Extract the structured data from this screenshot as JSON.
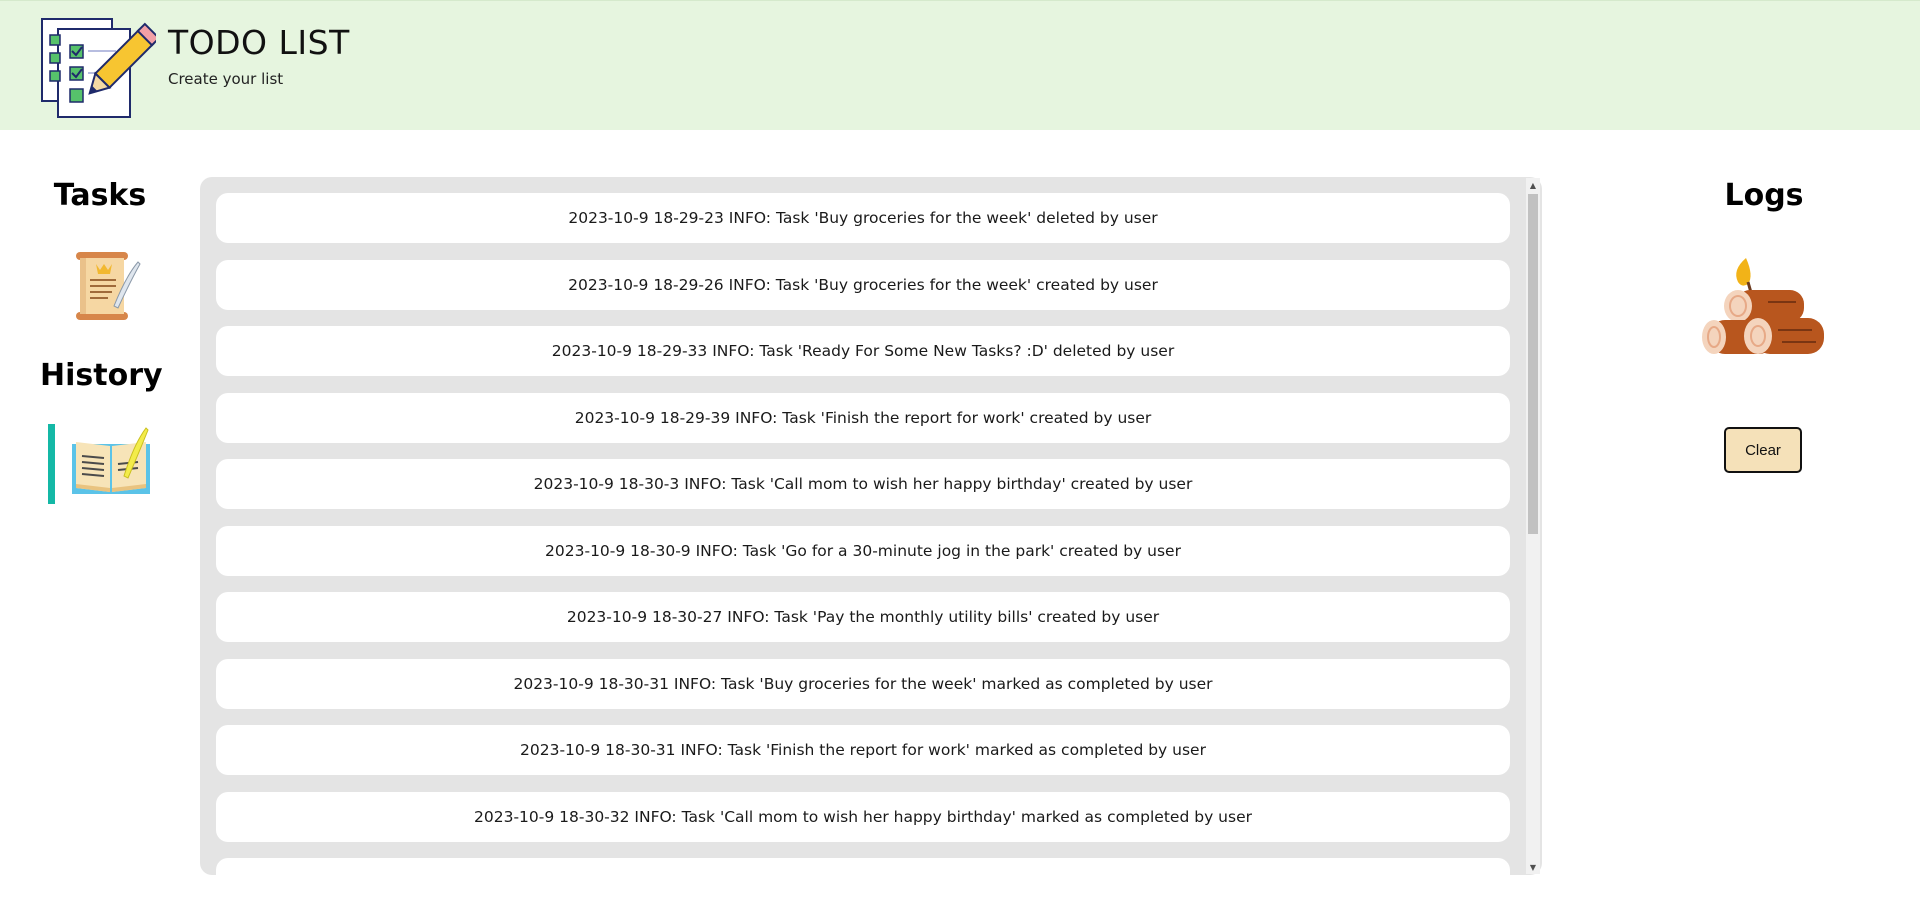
{
  "header": {
    "title": "TODO LIST",
    "subtitle": "Create your list",
    "logo_icon": "checklist-pencil-icon",
    "background": "#e6f5df"
  },
  "sidebar": {
    "tasks_heading": "Tasks",
    "tasks_icon": "scroll-quill-icon",
    "history_heading": "History",
    "history_icon": "open-book-quill-icon",
    "active_item": "History",
    "active_color": "#14b8a6"
  },
  "log_entries": [
    "2023-10-9 18-29-23 INFO: Task 'Buy groceries for the week' deleted by user",
    "2023-10-9 18-29-26 INFO: Task 'Buy groceries for the week' created by user",
    "2023-10-9 18-29-33 INFO: Task 'Ready For Some New Tasks? :D' deleted by user",
    "2023-10-9 18-29-39 INFO: Task 'Finish the report for work' created by user",
    "2023-10-9 18-30-3 INFO: Task 'Call mom to wish her happy birthday' created by user",
    "2023-10-9 18-30-9 INFO: Task 'Go for a 30-minute jog in the park' created by user",
    "2023-10-9 18-30-27 INFO: Task 'Pay the monthly utility bills' created by user",
    "2023-10-9 18-30-31 INFO: Task 'Buy groceries for the week' marked as completed by user",
    "2023-10-9 18-30-31 INFO: Task 'Finish the report for work' marked as completed by user",
    "2023-10-9 18-30-32 INFO: Task 'Call mom to wish her happy birthday' marked as completed by user",
    ""
  ],
  "logs_panel": {
    "heading": "Logs",
    "icon": "firewood-logs-icon",
    "clear_label": "Clear",
    "clear_color": "#f5e1b9"
  }
}
